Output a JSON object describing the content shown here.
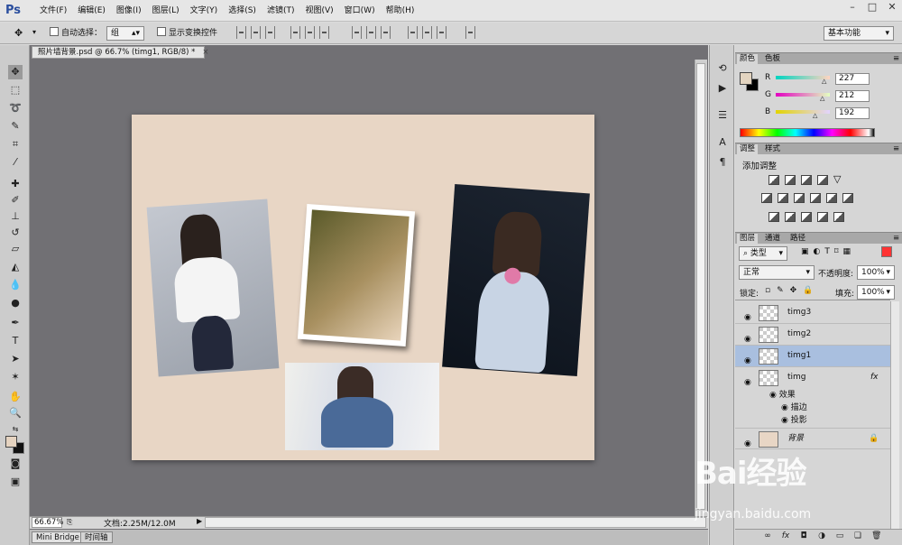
{
  "app": {
    "logo": "Ps"
  },
  "menu": [
    "文件(F)",
    "编辑(E)",
    "图像(I)",
    "图层(L)",
    "文字(Y)",
    "选择(S)",
    "滤镜(T)",
    "视图(V)",
    "窗口(W)",
    "帮助(H)"
  ],
  "window_controls": {
    "minimize": "–",
    "restore": "□",
    "close": "✕"
  },
  "options": {
    "auto_select_label": "自动选择：",
    "auto_select_value": "组",
    "show_transform_label": "显示变换控件",
    "workspace": "基本功能"
  },
  "document": {
    "tab_title": "照片墙背景.psd @ 66.7% (timg1, RGB/8) *",
    "close": "×",
    "zoom": "66.67%",
    "doc_size": "文档:2.25M/12.0M"
  },
  "bottom_tabs": [
    "Mini Bridge",
    "时间轴"
  ],
  "color_panel": {
    "tabs": [
      "颜色",
      "色板"
    ],
    "r_label": "R",
    "g_label": "G",
    "b_label": "B",
    "r": "227",
    "g": "212",
    "b": "192",
    "foreground": "#e3d4c0"
  },
  "adjust_panel": {
    "tabs": [
      "调整",
      "样式"
    ],
    "title": "添加调整"
  },
  "layers_panel": {
    "tabs": [
      "图层",
      "通道",
      "路径"
    ],
    "filter_label": "类型",
    "blend_mode": "正常",
    "opacity_label": "不透明度:",
    "opacity": "100%",
    "lock_label": "锁定:",
    "fill_label": "填充:",
    "fill": "100%",
    "layers": [
      {
        "name": "timg3"
      },
      {
        "name": "timg2"
      },
      {
        "name": "timg1"
      },
      {
        "name": "timg"
      }
    ],
    "fx_label": "fx",
    "effects_label": "效果",
    "effect_1": "描边",
    "effect_2": "投影",
    "background_layer": "背景"
  },
  "watermark": {
    "brand": "Bai经验",
    "url": "jingyan.baidu.com"
  }
}
